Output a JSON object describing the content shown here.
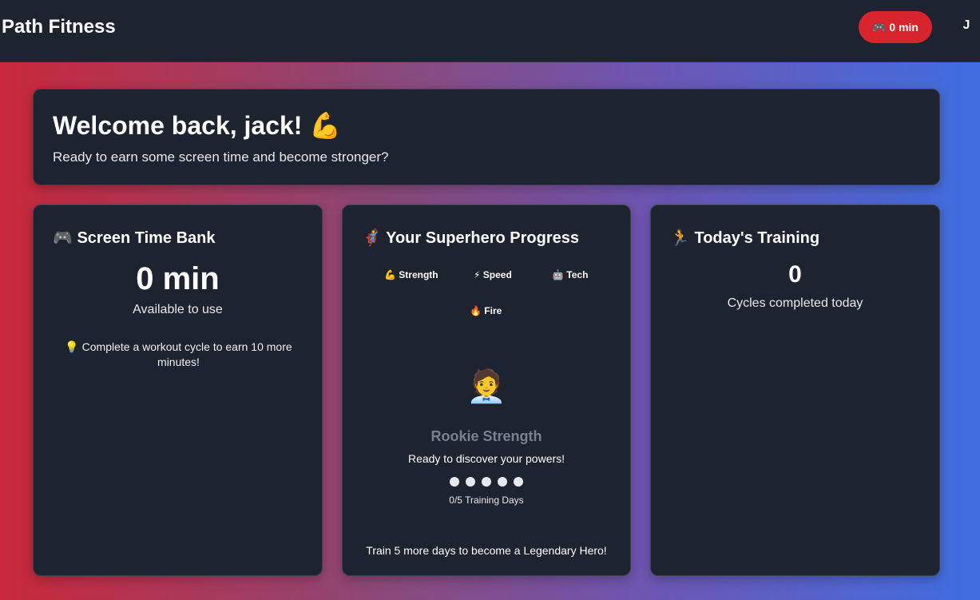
{
  "header": {
    "brand": "Path Fitness",
    "time_badge_icon": "🎮",
    "time_badge": "0 min",
    "avatar_initial": "J"
  },
  "welcome": {
    "title": "Welcome back, jack! 💪",
    "subtitle": "Ready to earn some screen time and become stronger?"
  },
  "screen_time": {
    "title": "🎮 Screen Time Bank",
    "value": "0 min",
    "label": "Available to use",
    "tip": "💡 Complete a workout cycle to earn 10 more minutes!"
  },
  "superhero": {
    "title": "🦸 Your Superhero Progress",
    "powers": [
      "💪 Strength",
      "⚡ Speed",
      "🤖 Tech",
      "🔥 Fire"
    ],
    "hero_emoji": "🧑‍💼",
    "rank": "Rookie Strength",
    "tagline": "Ready to discover your powers!",
    "progress_completed": 0,
    "progress_total": 5,
    "progress_label": "0/5 Training Days",
    "goal": "Train 5 more days to become a Legendary Hero!"
  },
  "training": {
    "title": "🏃 Today's Training",
    "cycles": "0",
    "cycles_label": "Cycles completed today"
  }
}
